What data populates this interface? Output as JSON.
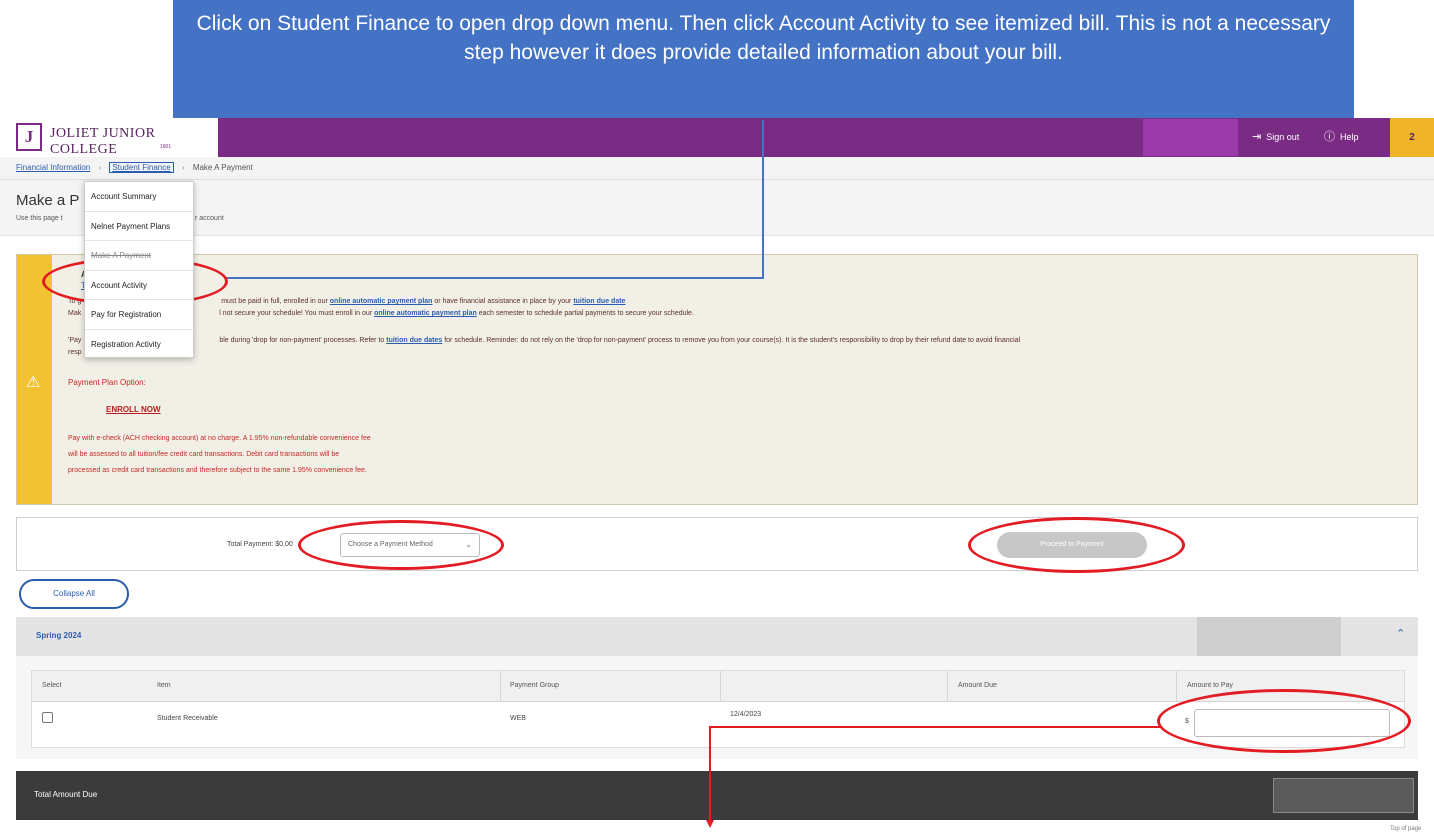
{
  "callout": {
    "text": "Click on Student Finance to open drop down menu. Then click Account Activity to see itemized bill. This is not a necessary step however it does provide detailed information about your bill."
  },
  "header": {
    "logo_text": "JOLIET JUNIOR COLLEGE",
    "logo_sub": "1901",
    "sign_out_label": "Sign out",
    "help_label": "Help",
    "notification_count": "2",
    "colors": {
      "primary": "#7a2b84",
      "accent": "#f0b429"
    }
  },
  "breadcrumb": {
    "items": [
      "Financial Information",
      "Student Finance",
      "Make A Payment"
    ]
  },
  "page": {
    "title_visible": "Make a P",
    "subtitle_visible": "Use this page t",
    "subtitle_end": "r account"
  },
  "dropdown": {
    "items": [
      "Account Summary",
      "Nelnet Payment Plans",
      "Make A Payment",
      "Account Activity",
      "Pay for Registration",
      "Registration Activity"
    ]
  },
  "alert": {
    "title_visible": "Ale",
    "link_visible": "Tuit",
    "line1_prefix": "To g",
    "line1_mid": "must be paid in full, enrolled in our",
    "line1_link1": "online automatic payment plan",
    "line1_mid2": "or have financial assistance in place by your",
    "line1_link2": "tuition due date",
    "line2_prefix": "Mak",
    "line2_mid": "l not secure your schedule!  You must enroll in our",
    "line2_link": "online automatic payment plan",
    "line2_end": "each semester to schedule partial payments to secure your schedule.",
    "line3_prefix": "'Pay",
    "line3_mid": "ble during 'drop for non-payment' processes.  Refer to",
    "line3_link": "tuition due dates",
    "line3_end": "for schedule.  Reminder: do not rely on the 'drop for non-payment' process to remove you from your course(s).  It is the student's responsibility to drop by their refund date to avoid financial",
    "line4_prefix": "resp",
    "plan_option": "Payment Plan Option:",
    "enroll_label": "ENROLL NOW",
    "fee_line1": "Pay with e-check (ACH checking account) at no charge.  A 1.95% non-refundable convenience fee",
    "fee_line2": "will be assessed to all tuition/fee credit card transactions.  Debit card transactions will be",
    "fee_line3": "processed as credit card transactions and therefore subject to the same 1.95% convenience fee."
  },
  "payment": {
    "total_label": "Total Payment: $0.00",
    "method_placeholder": "Choose a Payment Method",
    "proceed_label": "Proceed to Payment"
  },
  "collapse_label": "Collapse All",
  "term": {
    "name": "Spring 2024",
    "columns": [
      "Select",
      "Item",
      "Payment Group",
      "",
      "Amount Due",
      "Amount to Pay"
    ],
    "rows": [
      {
        "item": "Student Receivable",
        "group": "WEB",
        "date": "12/4/2023",
        "amount_due": "",
        "currency": "$"
      }
    ]
  },
  "total_amount_due_label": "Total Amount Due",
  "top_of_page": "Top of page"
}
